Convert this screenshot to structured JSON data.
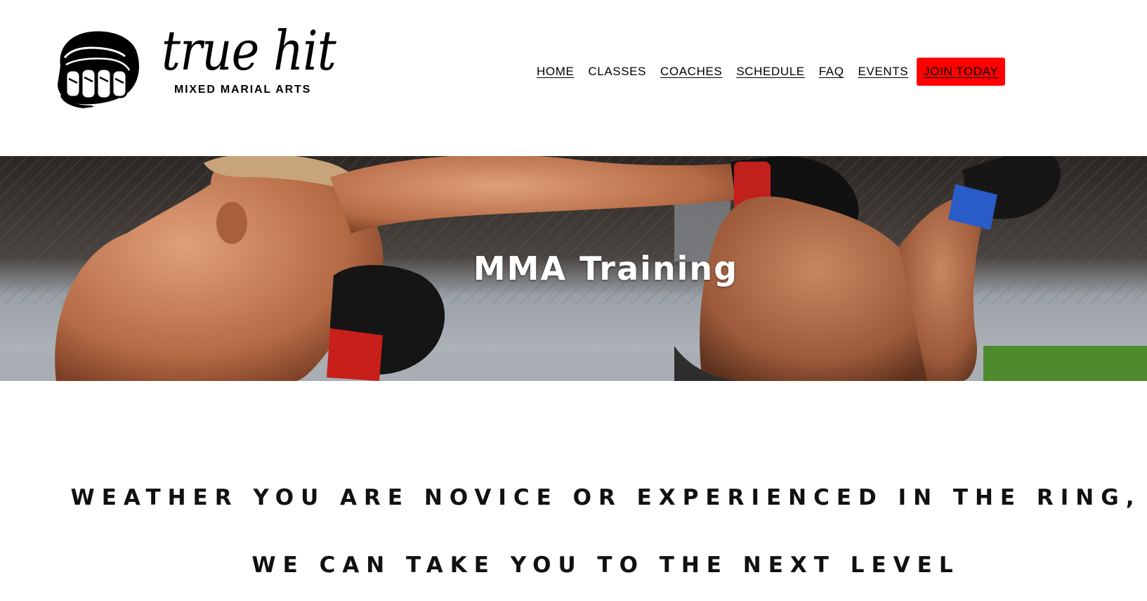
{
  "logo": {
    "name": "true hit",
    "tagline": "MIXED MARIAL ARTS"
  },
  "nav": {
    "home": "HOME",
    "classes": "CLASSES",
    "coaches": "COACHES",
    "schedule": "SCHEDULE",
    "faq": "FAQ",
    "events": "EVENTS",
    "join": "JOIN TODAY"
  },
  "hero": {
    "title": "MMA Training",
    "image": "mma-fighters-photo"
  },
  "tagline": {
    "line1": "WEATHER YOU ARE NOVICE OR EXPERIENCED IN THE RING,",
    "line2": "WE CAN TAKE YOU TO THE NEXT LEVEL"
  },
  "colors": {
    "accent": "#ff0000",
    "text": "#000000",
    "background": "#ffffff"
  }
}
